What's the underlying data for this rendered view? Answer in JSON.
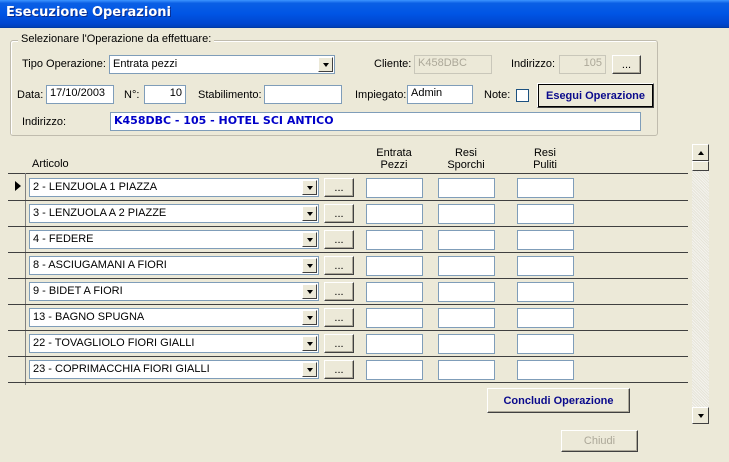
{
  "window": {
    "title": "Esecuzione Operazioni"
  },
  "group": {
    "title": "Selezionare l'Operazione da effettuare:"
  },
  "form": {
    "tipo_label": "Tipo Operazione:",
    "tipo_value": "Entrata pezzi",
    "cliente_label": "Cliente:",
    "cliente_value": "K458DBC",
    "indirizzo_label": "Indirizzo:",
    "indirizzo_code": "105",
    "lookup_button": "...",
    "data_label": "Data:",
    "data_value": "17/10/2003",
    "numero_label": "N°:",
    "numero_value": "10",
    "stabilimento_label": "Stabilimento:",
    "stabilimento_value": "",
    "impiegato_label": "Impiegato:",
    "impiegato_value": "Admin",
    "note_label": "Note:",
    "esegui_button": "Esegui Operazione",
    "indirizzo2_label": "Indirizzo:",
    "indirizzo_full": "K458DBC - 105 - HOTEL SCI ANTICO"
  },
  "grid": {
    "col_articolo": "Articolo",
    "col_entrata": [
      "Entrata",
      "Pezzi"
    ],
    "col_sporchi": [
      "Resi",
      "Sporchi"
    ],
    "col_puliti": [
      "Resi",
      "Puliti"
    ],
    "row_button": "...",
    "rows": [
      {
        "articolo": "2 - LENZUOLA 1 PIAZZA",
        "current": true
      },
      {
        "articolo": "3 - LENZUOLA A 2 PIAZZE",
        "current": false
      },
      {
        "articolo": "4 - FEDERE",
        "current": false
      },
      {
        "articolo": "8 - ASCIUGAMANI A FIORI",
        "current": false
      },
      {
        "articolo": "9 - BIDET A FIORI",
        "current": false
      },
      {
        "articolo": "13 - BAGNO SPUGNA",
        "current": false
      },
      {
        "articolo": "22 - TOVAGLIOLO FIORI GIALLI",
        "current": false
      },
      {
        "articolo": "23 - COPRIMACCHIA FIORI GIALLI",
        "current": false
      }
    ]
  },
  "buttons": {
    "concludi": "Concludi Operazione",
    "chiudi": "Chiudi"
  }
}
